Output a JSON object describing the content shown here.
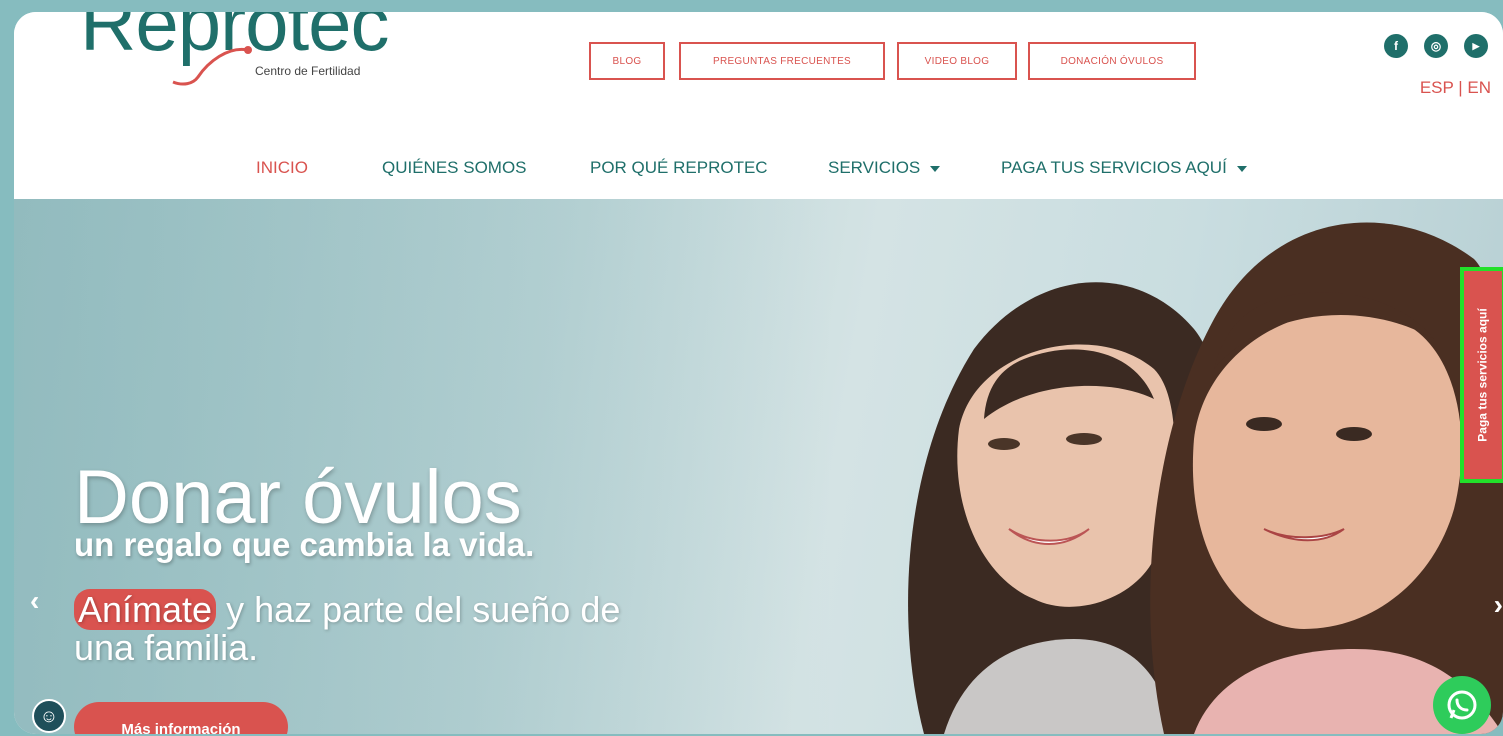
{
  "logo": {
    "wordmark": "Reprotec",
    "tagline": "Centro de Fertilidad"
  },
  "top_buttons": [
    "BLOG",
    "PREGUNTAS FRECUENTES",
    "VIDEO BLOG",
    "DONACIÓN ÓVULOS"
  ],
  "social": [
    {
      "icon": "facebook-icon",
      "glyph": "f"
    },
    {
      "icon": "instagram-icon",
      "glyph": "◎"
    },
    {
      "icon": "youtube-icon",
      "glyph": "▶"
    }
  ],
  "language": "ESP | EN",
  "nav": {
    "inicio": "INICIO",
    "quienes": "QUIÉNES SOMOS",
    "porque": "POR QUÉ REPROTEC",
    "servicios": "SERVICIOS",
    "paga": "PAGA TUS SERVICIOS AQUÍ"
  },
  "hero": {
    "headline": "Donar óvulos",
    "subhead": "un regalo que cambia la vida.",
    "highlight": "Anímate",
    "tag_rest": " y haz parte del sueño de una familia.",
    "cta": "Más información"
  },
  "side_tab": "Paga tus servicios aquí",
  "colors": {
    "brand_teal": "#1f6f6a",
    "accent_red": "#d9534f",
    "whatsapp": "#2ecc5b"
  }
}
